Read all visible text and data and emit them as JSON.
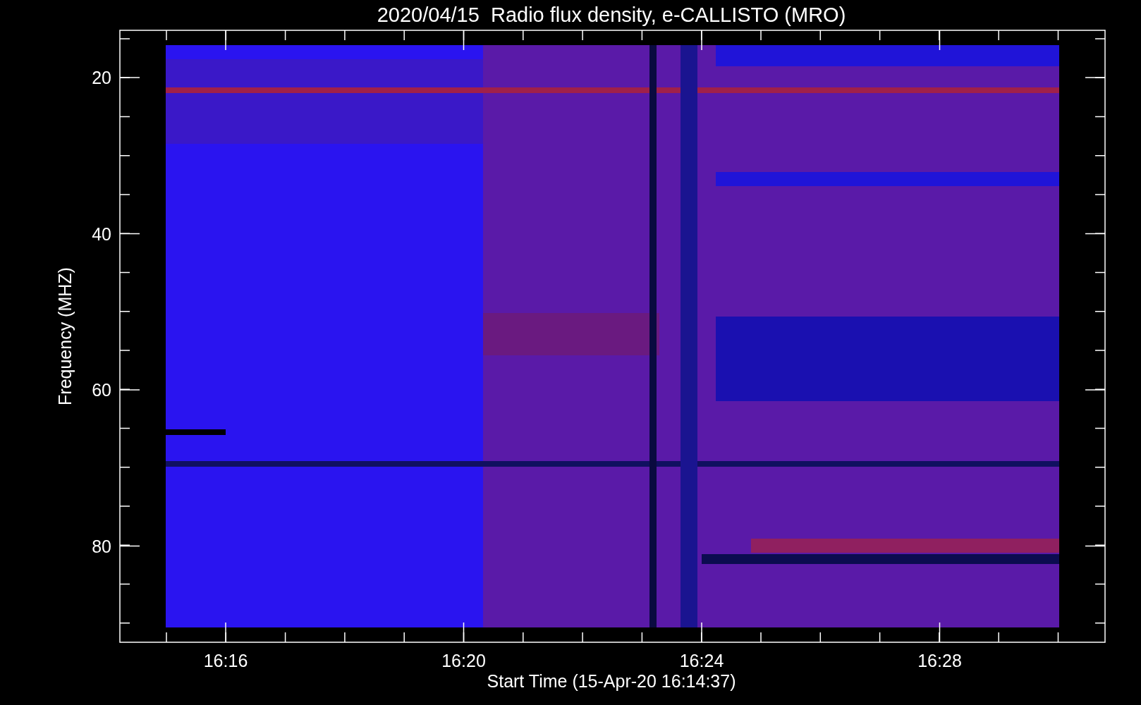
{
  "plot": {
    "title": "2020/04/15  Radio flux density, e-CALLISTO (MRO)",
    "y_axis": {
      "label": "Frequency (MHZ)",
      "ticks": [
        "20",
        "40",
        "60",
        "80"
      ]
    },
    "x_axis": {
      "label": "Start Time (15-Apr-20 16:14:37)",
      "ticks": [
        "16:16",
        "16:20",
        "16:24",
        "16:28"
      ]
    }
  }
}
